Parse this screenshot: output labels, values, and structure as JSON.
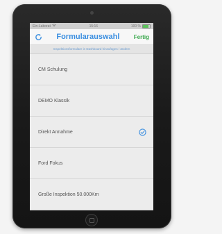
{
  "status_bar": {
    "carrier": "Ein-Laborat",
    "time": "15:16",
    "battery": "100 %"
  },
  "nav": {
    "title": "Formularauswahl",
    "done_label": "Fertig",
    "refresh_icon": "refresh-icon"
  },
  "subtitle": "Inspektionsformulare in Dashboard hinzufügen / ändern",
  "list": {
    "items": [
      {
        "label": "CM Schulung",
        "selected": false
      },
      {
        "label": "DEMO Klassik",
        "selected": false
      },
      {
        "label": "Direkt Annahme",
        "selected": true
      },
      {
        "label": "Ford Fokus",
        "selected": false
      },
      {
        "label": "Große Inspektion 50.000Km",
        "selected": false
      }
    ]
  },
  "colors": {
    "accent": "#3a8ee0",
    "done": "#3aa84c"
  }
}
